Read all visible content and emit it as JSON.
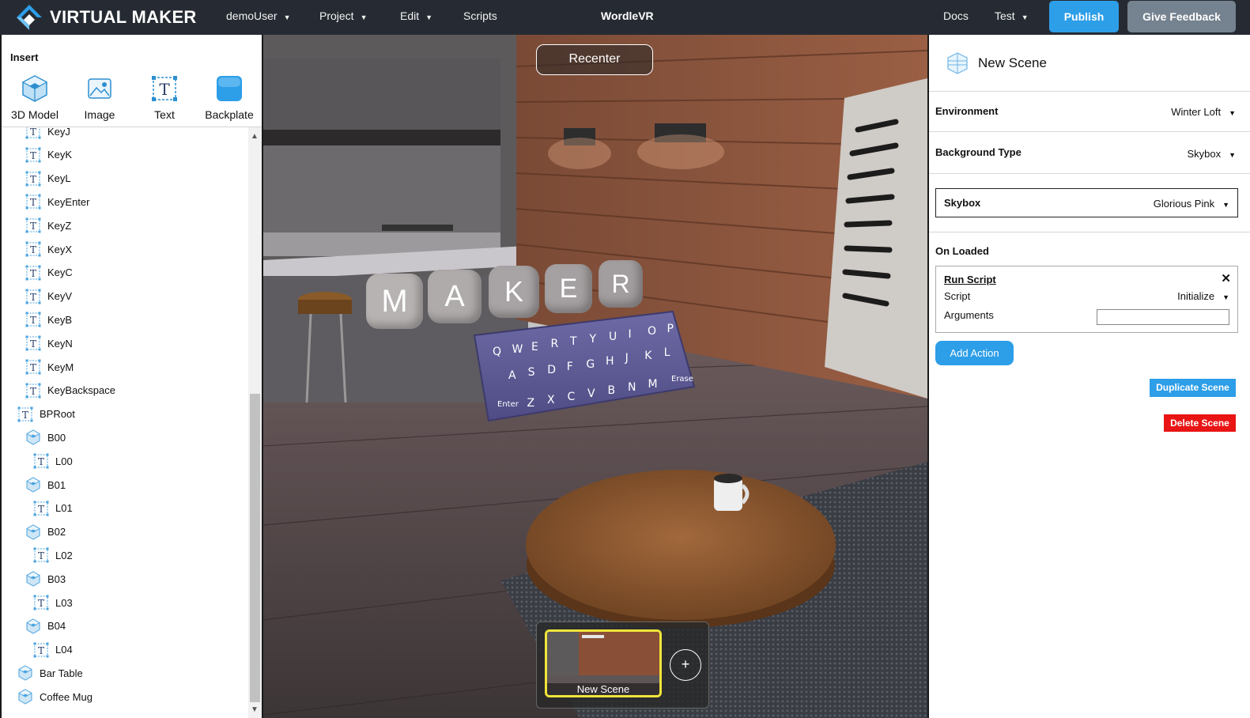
{
  "topbar": {
    "brand": "VIRTUAL MAKER",
    "menus": {
      "user": "demoUser",
      "project": "Project",
      "edit": "Edit",
      "scripts": "Scripts",
      "docs": "Docs",
      "test": "Test"
    },
    "project_title": "WordleVR",
    "publish_label": "Publish",
    "feedback_label": "Give Feedback"
  },
  "insert": {
    "heading": "Insert",
    "items": [
      {
        "label": "3D Model",
        "icon": "cube-icon"
      },
      {
        "label": "Image",
        "icon": "image-icon"
      },
      {
        "label": "Text",
        "icon": "text-icon"
      },
      {
        "label": "Backplate",
        "icon": "backplate-icon"
      }
    ]
  },
  "tree": [
    {
      "label": "KeyJ",
      "type": "text"
    },
    {
      "label": "KeyK",
      "type": "text"
    },
    {
      "label": "KeyL",
      "type": "text"
    },
    {
      "label": "KeyEnter",
      "type": "text"
    },
    {
      "label": "KeyZ",
      "type": "text"
    },
    {
      "label": "KeyX",
      "type": "text"
    },
    {
      "label": "KeyC",
      "type": "text"
    },
    {
      "label": "KeyV",
      "type": "text"
    },
    {
      "label": "KeyB",
      "type": "text"
    },
    {
      "label": "KeyN",
      "type": "text"
    },
    {
      "label": "KeyM",
      "type": "text"
    },
    {
      "label": "KeyBackspace",
      "type": "text"
    },
    {
      "label": "BPRoot",
      "type": "text"
    },
    {
      "label": "B00",
      "type": "model"
    },
    {
      "label": "L00",
      "type": "text"
    },
    {
      "label": "B01",
      "type": "model"
    },
    {
      "label": "L01",
      "type": "text"
    },
    {
      "label": "B02",
      "type": "model"
    },
    {
      "label": "L02",
      "type": "text"
    },
    {
      "label": "B03",
      "type": "model"
    },
    {
      "label": "L03",
      "type": "text"
    },
    {
      "label": "B04",
      "type": "model"
    },
    {
      "label": "L04",
      "type": "text"
    },
    {
      "label": "Bar Table",
      "type": "model"
    },
    {
      "label": "Coffee Mug",
      "type": "model"
    }
  ],
  "viewport": {
    "recenter_label": "Recenter",
    "word_tiles": [
      "M",
      "A",
      "K",
      "E",
      "R"
    ],
    "keyboard": {
      "row1": [
        "Q",
        "W",
        "E",
        "R",
        "T",
        "Y",
        "U",
        "I",
        "O",
        "P"
      ],
      "row2": [
        "A",
        "S",
        "D",
        "F",
        "G",
        "H",
        "J",
        "K",
        "L"
      ],
      "row3": [
        "Enter",
        "Z",
        "X",
        "C",
        "V",
        "B",
        "N",
        "M",
        "Erase"
      ]
    },
    "scene_thumb_label": "New Scene",
    "add_scene_symbol": "+"
  },
  "inspector": {
    "scene_name": "New Scene",
    "environment_label": "Environment",
    "environment_value": "Winter Loft",
    "background_type_label": "Background Type",
    "background_type_value": "Skybox",
    "skybox_label": "Skybox",
    "skybox_value": "Glorious Pink",
    "on_loaded_label": "On Loaded",
    "action": {
      "title": "Run Script",
      "close_symbol": "✕",
      "script_label": "Script",
      "script_value": "Initialize",
      "arguments_label": "Arguments",
      "arguments_value": ""
    },
    "add_action_label": "Add Action",
    "duplicate_label": "Duplicate Scene",
    "delete_label": "Delete Scene"
  },
  "colors": {
    "topbar": "#262b33",
    "accent": "#2d9ee8",
    "feedback": "#75828f",
    "danger": "#e91515",
    "highlight": "#f0e53a"
  }
}
